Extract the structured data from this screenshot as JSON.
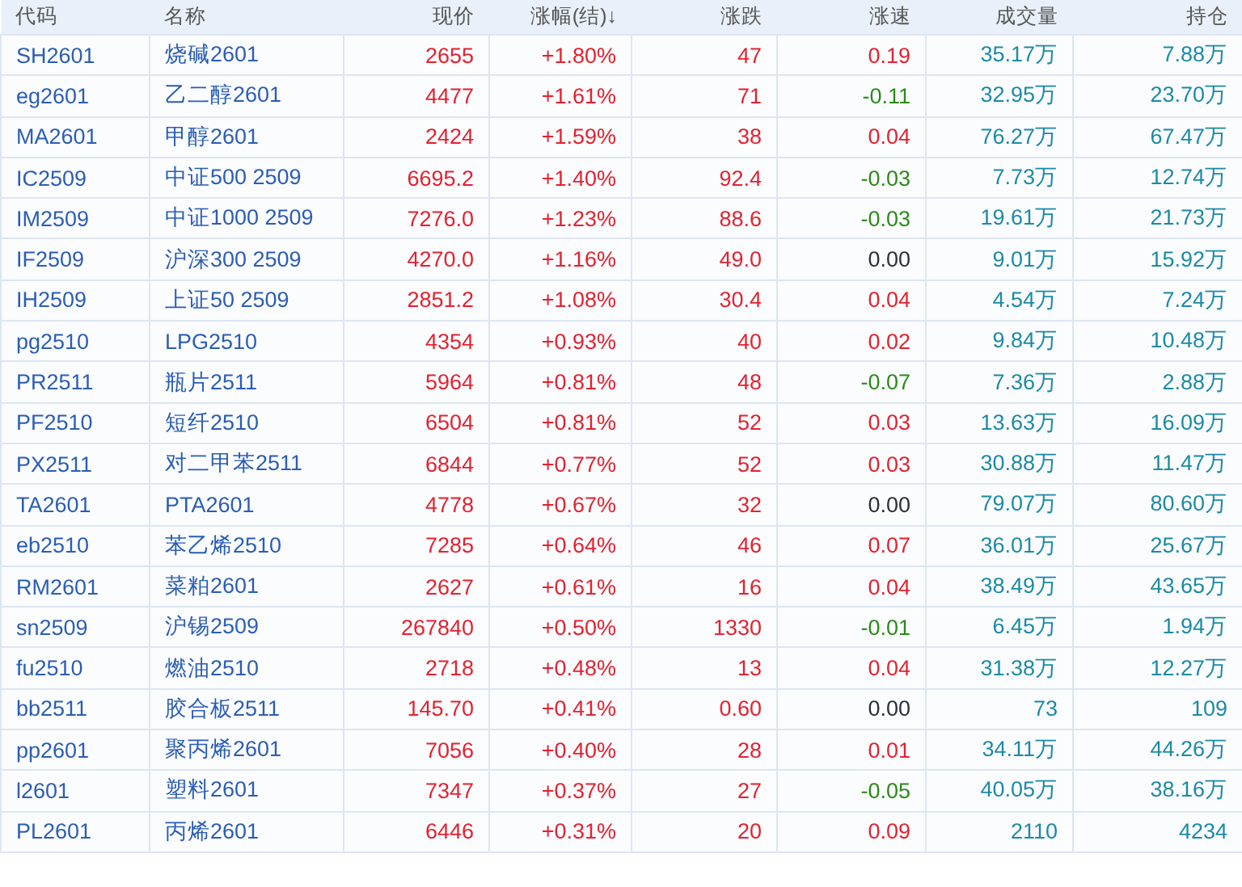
{
  "columns": [
    "代码",
    "名称",
    "现价",
    "涨幅(结)↓",
    "涨跌",
    "涨速",
    "成交量",
    "持仓"
  ],
  "rows": [
    {
      "code": "SH2601",
      "name": "烧碱2601",
      "price": "2655",
      "pct": "+1.80%",
      "change": "47",
      "color": "#e5202e",
      "speed": {
        "text": "0.19",
        "color": "#e5202e"
      },
      "volume": "35.17万",
      "open_interest": "7.88万"
    },
    {
      "code": "eg2601",
      "name": "乙二醇2601",
      "price": "4477",
      "pct": "+1.61%",
      "change": "71",
      "color": "#e5202e",
      "speed": {
        "text": "-0.11",
        "color": "#2a8a18"
      },
      "volume": "32.95万",
      "open_interest": "23.70万"
    },
    {
      "code": "MA2601",
      "name": "甲醇2601",
      "price": "2424",
      "pct": "+1.59%",
      "change": "38",
      "color": "#e5202e",
      "speed": {
        "text": "0.04",
        "color": "#e5202e"
      },
      "volume": "76.27万",
      "open_interest": "67.47万"
    },
    {
      "code": "IC2509",
      "name": "中证500 2509",
      "price": "6695.2",
      "pct": "+1.40%",
      "change": "92.4",
      "color": "#e5202e",
      "speed": {
        "text": "-0.03",
        "color": "#2a8a18"
      },
      "volume": "7.73万",
      "open_interest": "12.74万"
    },
    {
      "code": "IM2509",
      "name": "中证1000 2509",
      "price": "7276.0",
      "pct": "+1.23%",
      "change": "88.6",
      "color": "#e5202e",
      "speed": {
        "text": "-0.03",
        "color": "#2a8a18"
      },
      "volume": "19.61万",
      "open_interest": "21.73万"
    },
    {
      "code": "IF2509",
      "name": "沪深300 2509",
      "price": "4270.0",
      "pct": "+1.16%",
      "change": "49.0",
      "color": "#e5202e",
      "speed": {
        "text": "0.00",
        "color": "#2a2f3a"
      },
      "volume": "9.01万",
      "open_interest": "15.92万"
    },
    {
      "code": "IH2509",
      "name": "上证50 2509",
      "price": "2851.2",
      "pct": "+1.08%",
      "change": "30.4",
      "color": "#e5202e",
      "speed": {
        "text": "0.04",
        "color": "#e5202e"
      },
      "volume": "4.54万",
      "open_interest": "7.24万"
    },
    {
      "code": "pg2510",
      "name": "LPG2510",
      "price": "4354",
      "pct": "+0.93%",
      "change": "40",
      "color": "#e5202e",
      "speed": {
        "text": "0.02",
        "color": "#e5202e"
      },
      "volume": "9.84万",
      "open_interest": "10.48万"
    },
    {
      "code": "PR2511",
      "name": "瓶片2511",
      "price": "5964",
      "pct": "+0.81%",
      "change": "48",
      "color": "#e5202e",
      "speed": {
        "text": "-0.07",
        "color": "#2a8a18"
      },
      "volume": "7.36万",
      "open_interest": "2.88万"
    },
    {
      "code": "PF2510",
      "name": "短纤2510",
      "price": "6504",
      "pct": "+0.81%",
      "change": "52",
      "color": "#e5202e",
      "speed": {
        "text": "0.03",
        "color": "#e5202e"
      },
      "volume": "13.63万",
      "open_interest": "16.09万"
    },
    {
      "code": "PX2511",
      "name": "对二甲苯2511",
      "price": "6844",
      "pct": "+0.77%",
      "change": "52",
      "color": "#e5202e",
      "speed": {
        "text": "0.03",
        "color": "#e5202e"
      },
      "volume": "30.88万",
      "open_interest": "11.47万"
    },
    {
      "code": "TA2601",
      "name": "PTA2601",
      "price": "4778",
      "pct": "+0.67%",
      "change": "32",
      "color": "#e5202e",
      "speed": {
        "text": "0.00",
        "color": "#2a2f3a"
      },
      "volume": "79.07万",
      "open_interest": "80.60万"
    },
    {
      "code": "eb2510",
      "name": "苯乙烯2510",
      "price": "7285",
      "pct": "+0.64%",
      "change": "46",
      "color": "#e5202e",
      "speed": {
        "text": "0.07",
        "color": "#e5202e"
      },
      "volume": "36.01万",
      "open_interest": "25.67万"
    },
    {
      "code": "RM2601",
      "name": "菜粕2601",
      "price": "2627",
      "pct": "+0.61%",
      "change": "16",
      "color": "#e5202e",
      "speed": {
        "text": "0.04",
        "color": "#e5202e"
      },
      "volume": "38.49万",
      "open_interest": "43.65万"
    },
    {
      "code": "sn2509",
      "name": "沪锡2509",
      "price": "267840",
      "pct": "+0.50%",
      "change": "1330",
      "color": "#e5202e",
      "speed": {
        "text": "-0.01",
        "color": "#2a8a18"
      },
      "volume": "6.45万",
      "open_interest": "1.94万"
    },
    {
      "code": "fu2510",
      "name": "燃油2510",
      "price": "2718",
      "pct": "+0.48%",
      "change": "13",
      "color": "#e5202e",
      "speed": {
        "text": "0.04",
        "color": "#e5202e"
      },
      "volume": "31.38万",
      "open_interest": "12.27万"
    },
    {
      "code": "bb2511",
      "name": "胶合板2511",
      "price": "145.70",
      "pct": "+0.41%",
      "change": "0.60",
      "color": "#e5202e",
      "speed": {
        "text": "0.00",
        "color": "#2a2f3a"
      },
      "volume": "73",
      "open_interest": "109"
    },
    {
      "code": "pp2601",
      "name": "聚丙烯2601",
      "price": "7056",
      "pct": "+0.40%",
      "change": "28",
      "color": "#e5202e",
      "speed": {
        "text": "0.01",
        "color": "#e5202e"
      },
      "volume": "34.11万",
      "open_interest": "44.26万"
    },
    {
      "code": "l2601",
      "name": "塑料2601",
      "price": "7347",
      "pct": "+0.37%",
      "change": "27",
      "color": "#e5202e",
      "speed": {
        "text": "-0.05",
        "color": "#2a8a18"
      },
      "volume": "40.05万",
      "open_interest": "38.16万"
    },
    {
      "code": "PL2601",
      "name": "丙烯2601",
      "price": "6446",
      "pct": "+0.31%",
      "change": "20",
      "color": "#e5202e",
      "speed": {
        "text": "0.09",
        "color": "#e5202e"
      },
      "volume": "2110",
      "open_interest": "4234"
    }
  ]
}
